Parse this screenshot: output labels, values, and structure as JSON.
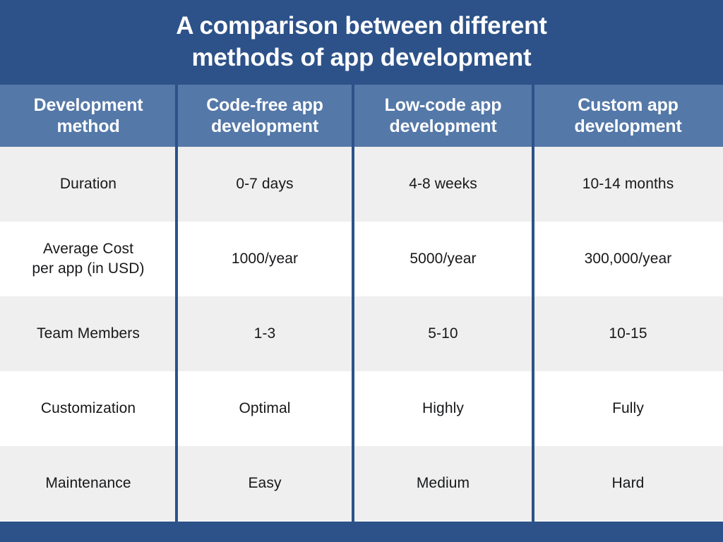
{
  "title": {
    "text": "A comparison between different\nmethods of app development"
  },
  "colors": {
    "banner_blue": "#2d5289",
    "header_row_blue": "#5478a8",
    "row_gray": "#efefef",
    "row_white": "#ffffff",
    "divider_blue": "#2d5289",
    "title_text": "#ffffff",
    "body_text": "#17181a"
  },
  "table": {
    "headers": [
      "Development\nmethod",
      "Code-free app\ndevelopment",
      "Low-code app\ndevelopment",
      "Custom app\ndevelopment"
    ],
    "rows": [
      {
        "shade": "gray",
        "cells": [
          "Duration",
          "0-7 days",
          "4-8 weeks",
          "10-14 months"
        ]
      },
      {
        "shade": "white",
        "cells": [
          "Average Cost\nper app (in USD)",
          "1000/year",
          "5000/year",
          "300,000/year"
        ]
      },
      {
        "shade": "gray",
        "cells": [
          "Team Members",
          "1-3",
          "5-10",
          "10-15"
        ]
      },
      {
        "shade": "white",
        "cells": [
          "Customization",
          "Optimal",
          "Highly",
          "Fully"
        ]
      },
      {
        "shade": "gray",
        "cells": [
          "Maintenance",
          "Easy",
          "Medium",
          "Hard"
        ]
      }
    ]
  }
}
